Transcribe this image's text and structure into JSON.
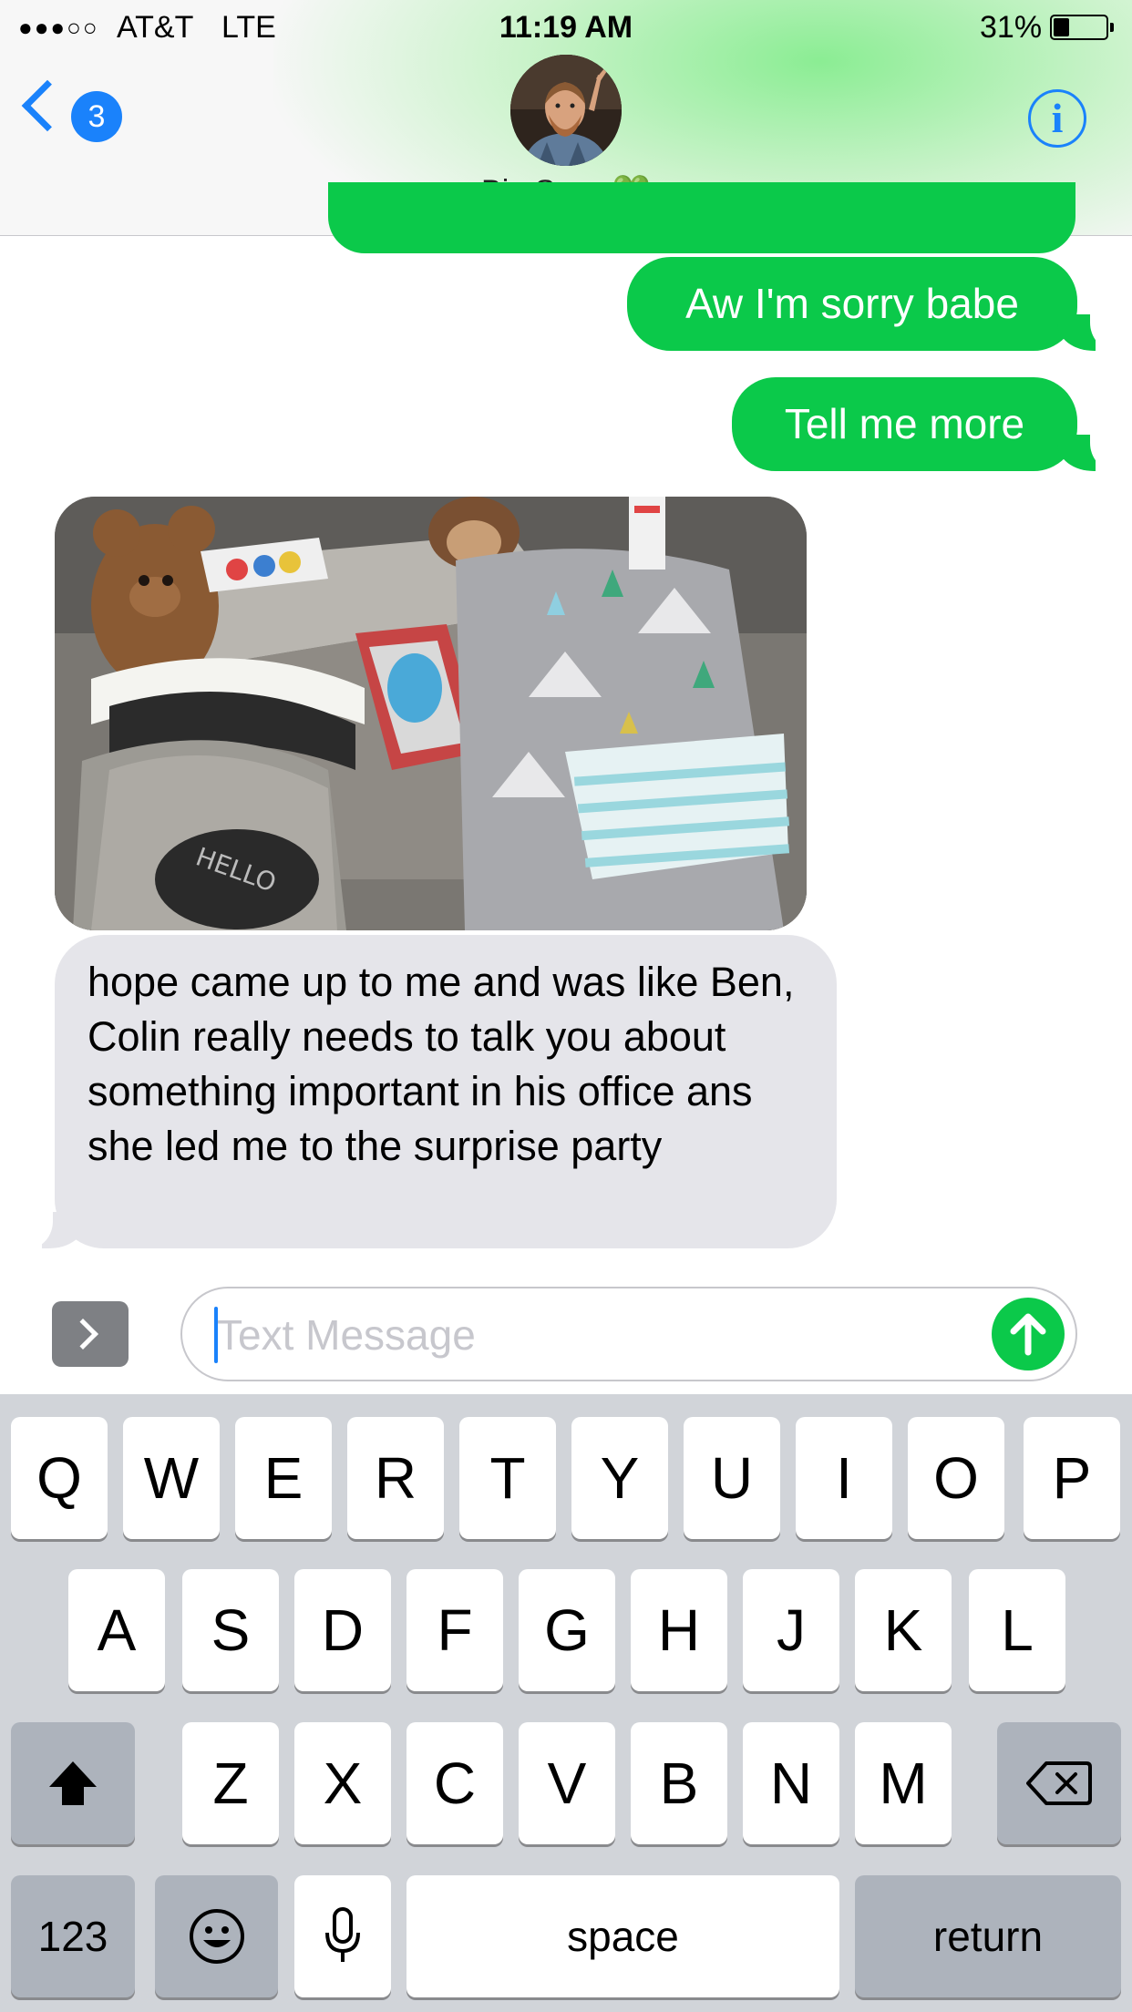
{
  "status_bar": {
    "signal": "●●●○○",
    "carrier": "AT&T",
    "network": "LTE",
    "time": "11:19 AM",
    "battery_percent": "31%",
    "battery_level": 0.31
  },
  "nav": {
    "back_badge": "3",
    "contact_name": "Big Sexy 💚",
    "info_label": "i"
  },
  "messages": [
    {
      "direction": "outgoing",
      "text": "Aw I'm sorry babe"
    },
    {
      "direction": "outgoing",
      "text": "Tell me more"
    },
    {
      "direction": "incoming",
      "type": "photo"
    },
    {
      "direction": "incoming",
      "text": "hope came up to me and was like Ben, Colin really needs to talk you about something important in his office ans she led me to the surprise party"
    }
  ],
  "compose": {
    "placeholder": "Text Message"
  },
  "keyboard": {
    "row1": [
      "Q",
      "W",
      "E",
      "R",
      "T",
      "Y",
      "U",
      "I",
      "O",
      "P"
    ],
    "row2": [
      "A",
      "S",
      "D",
      "F",
      "G",
      "H",
      "J",
      "K",
      "L"
    ],
    "row3": [
      "Z",
      "X",
      "C",
      "V",
      "B",
      "N",
      "M"
    ],
    "numbers_label": "123",
    "space_label": "space",
    "return_label": "return"
  },
  "colors": {
    "outgoing_bubble": "#0bc94a",
    "incoming_bubble": "#e5e5ea",
    "accent": "#1a82fb",
    "keyboard_bg": "#d1d4d9"
  }
}
